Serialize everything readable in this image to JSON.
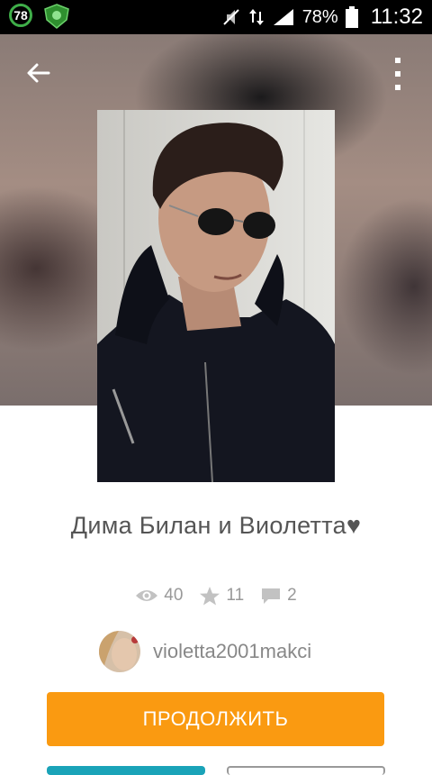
{
  "status_bar": {
    "badge_number": "78",
    "battery_percent": "78%",
    "time": "11:32",
    "icons": [
      "badge-icon",
      "shield-app-icon",
      "mute-icon",
      "data-arrows-icon",
      "signal-icon",
      "battery-icon"
    ]
  },
  "header": {
    "back_icon": "arrow-left-icon",
    "menu_icon": "more-vertical-icon"
  },
  "story": {
    "title": "Дима Билан и Виолетта♥",
    "stats": {
      "views": "40",
      "stars": "11",
      "comments": "2"
    },
    "author": "violetta2001makci"
  },
  "actions": {
    "continue_label": "ПРОДОЛЖИТЬ"
  },
  "colors": {
    "accent_orange": "#fa9a11",
    "teal": "#1aa3b8",
    "status_green": "#3fae49"
  }
}
